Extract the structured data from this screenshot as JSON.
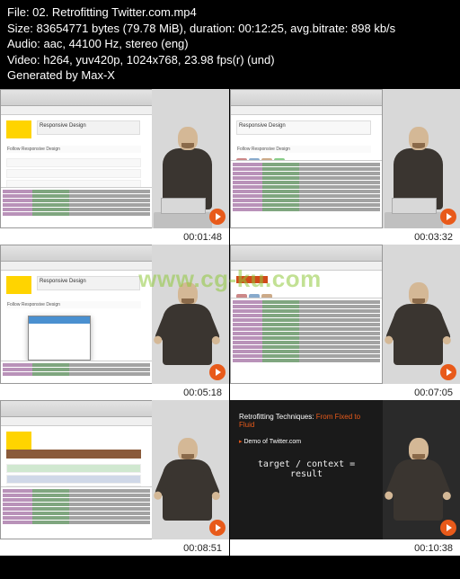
{
  "header": {
    "file_line": "File: 02. Retrofitting Twitter.com.mp4",
    "size_line": "Size: 83654771 bytes (79.78 MiB), duration: 00:12:25, avg.bitrate: 898 kb/s",
    "audio_line": "Audio: aac, 44100 Hz, stereo (eng)",
    "video_line": "Video: h264, yuv420p, 1024x768, 23.98 fps(r) (und)",
    "generated_line": "Generated by Max-X"
  },
  "watermark": "www.cg-ku.com",
  "thumbnails": [
    {
      "timestamp": "00:01:48"
    },
    {
      "timestamp": "00:03:32"
    },
    {
      "timestamp": "00:05:18"
    },
    {
      "timestamp": "00:07:05"
    },
    {
      "timestamp": "00:08:51"
    },
    {
      "timestamp": "00:10:38"
    }
  ],
  "browser": {
    "page_title": "Responsive Design",
    "follow_text": "Follow Responsive Design"
  },
  "slide": {
    "title_prefix": "Retrofitting Techniques:",
    "title_accent": "From Fixed to Fluid",
    "subtitle": "Demo of Twitter.com",
    "formula": "target / context = result"
  },
  "icons": {
    "play": "play-icon"
  }
}
